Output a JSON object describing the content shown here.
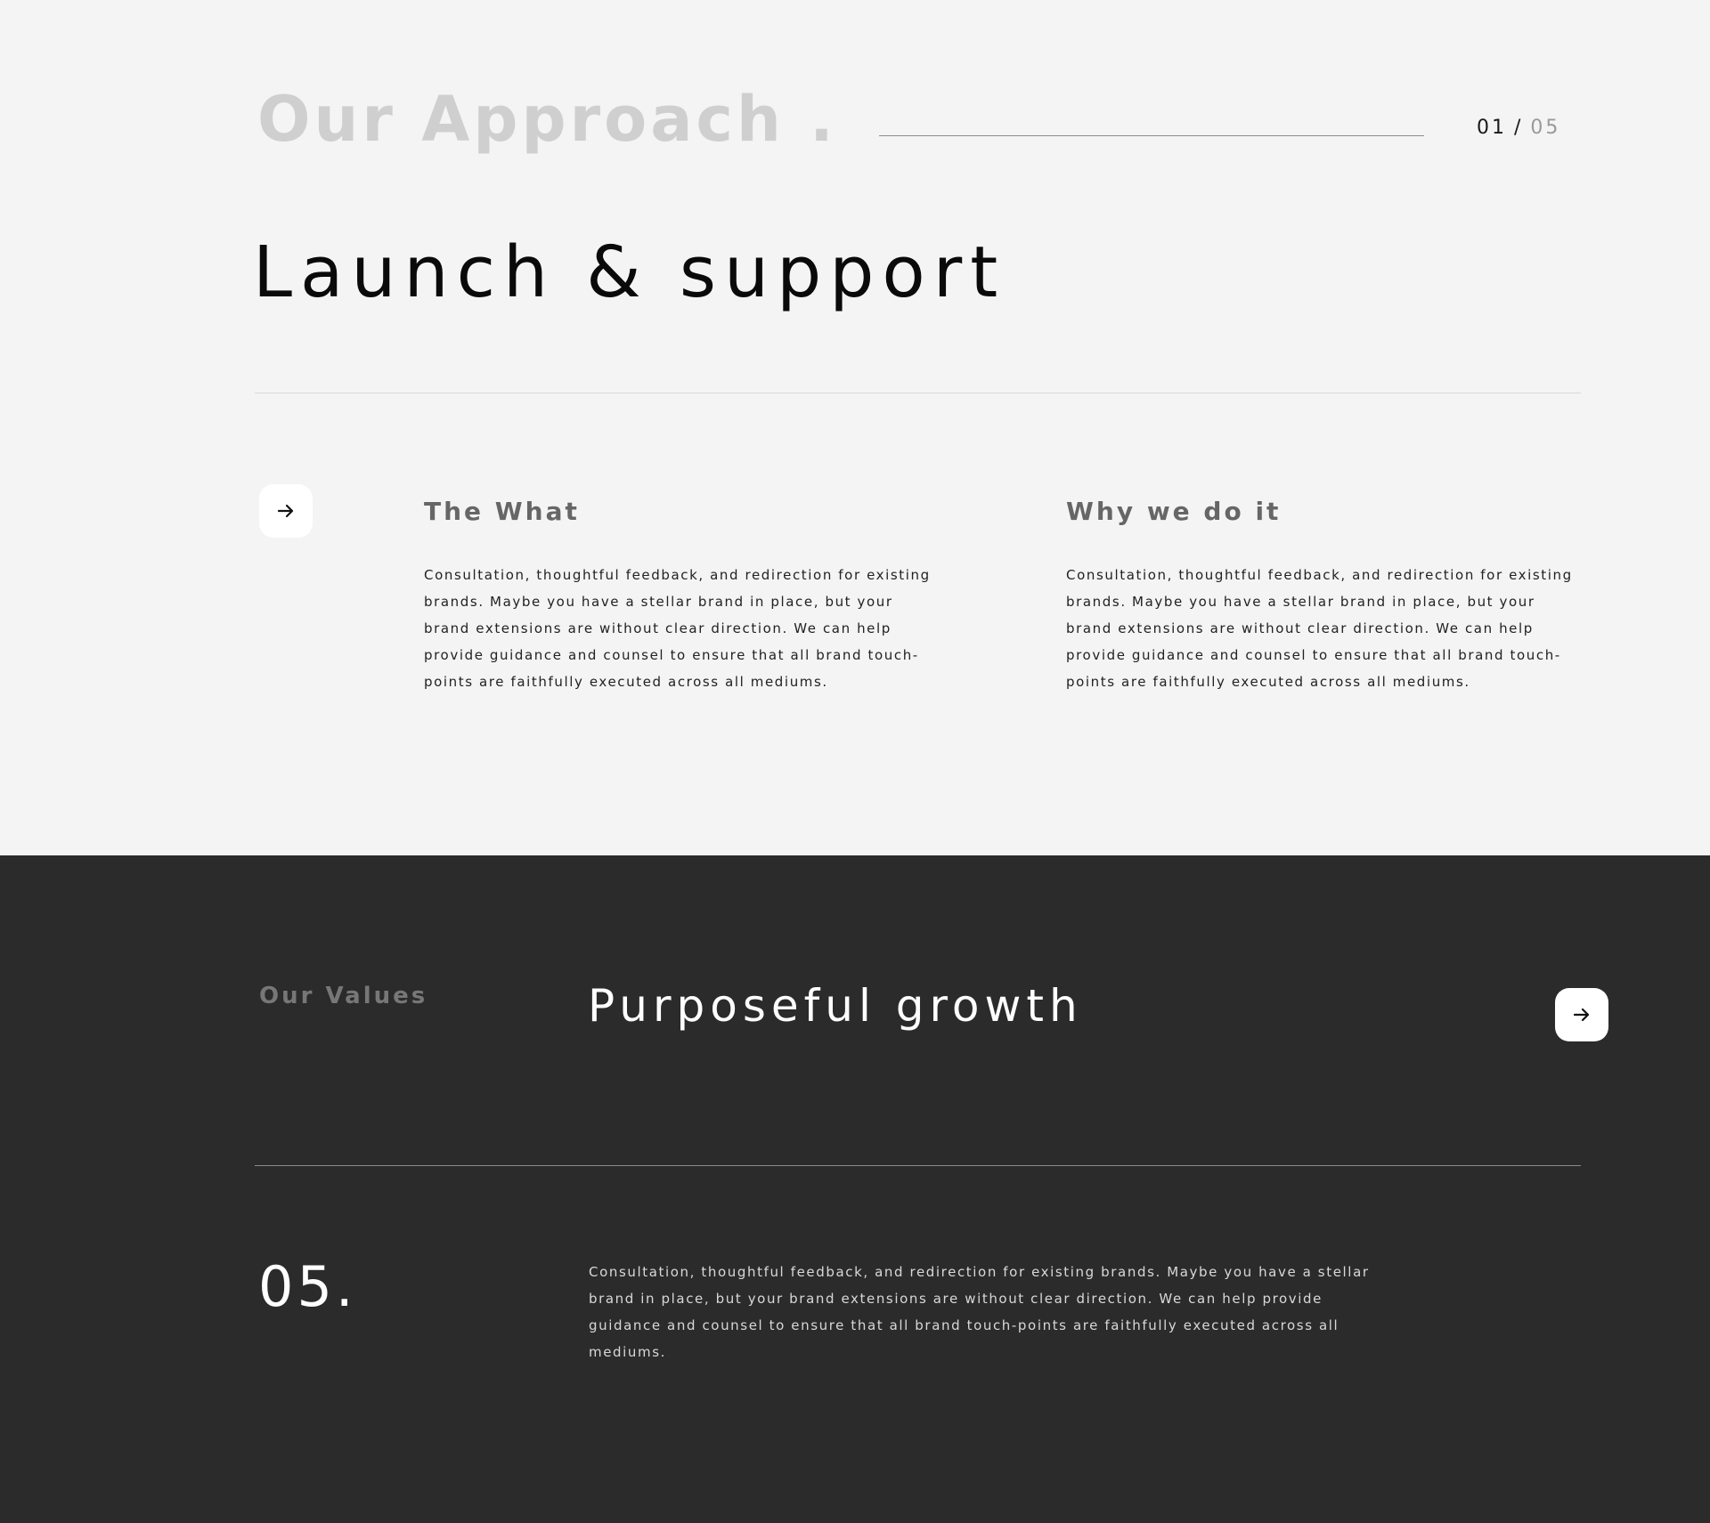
{
  "approach": {
    "heading": "Our Approach .",
    "counter_current": "01",
    "counter_separator": "/",
    "counter_total": "05",
    "title": "Launch & support",
    "arrow_icon": "arrow-right-icon",
    "what": {
      "title": "The What",
      "body": "Consultation, thoughtful feedback, and redirection for existing brands. Maybe you have a stellar brand in place, but your brand extensions are without clear direction. We can help provide guidance and counsel to ensure that all brand touch-points are faithfully executed across all mediums."
    },
    "why": {
      "title": "Why we do it",
      "body": "Consultation, thoughtful feedback, and redirection for existing brands. Maybe you have a stellar brand in place, but your brand extensions are without clear direction. We can help provide guidance and counsel to ensure that all brand touch-points are faithfully executed across all mediums."
    }
  },
  "values": {
    "label": "Our Values",
    "title": "Purposeful growth",
    "arrow_icon": "arrow-right-icon",
    "number": "05.",
    "body": "Consultation, thoughtful feedback, and redirection for existing brands. Maybe you have a stellar brand in place, but your brand extensions are without clear direction. We can help provide guidance and counsel to ensure that all brand touch-points are faithfully executed across all mediums."
  },
  "colors": {
    "light_bg": "#f4f4f4",
    "dark_bg": "#2b2b2b",
    "heading_gray": "#cfcfcf",
    "text_dark": "#0a0a0a",
    "text_light": "#ffffff"
  }
}
